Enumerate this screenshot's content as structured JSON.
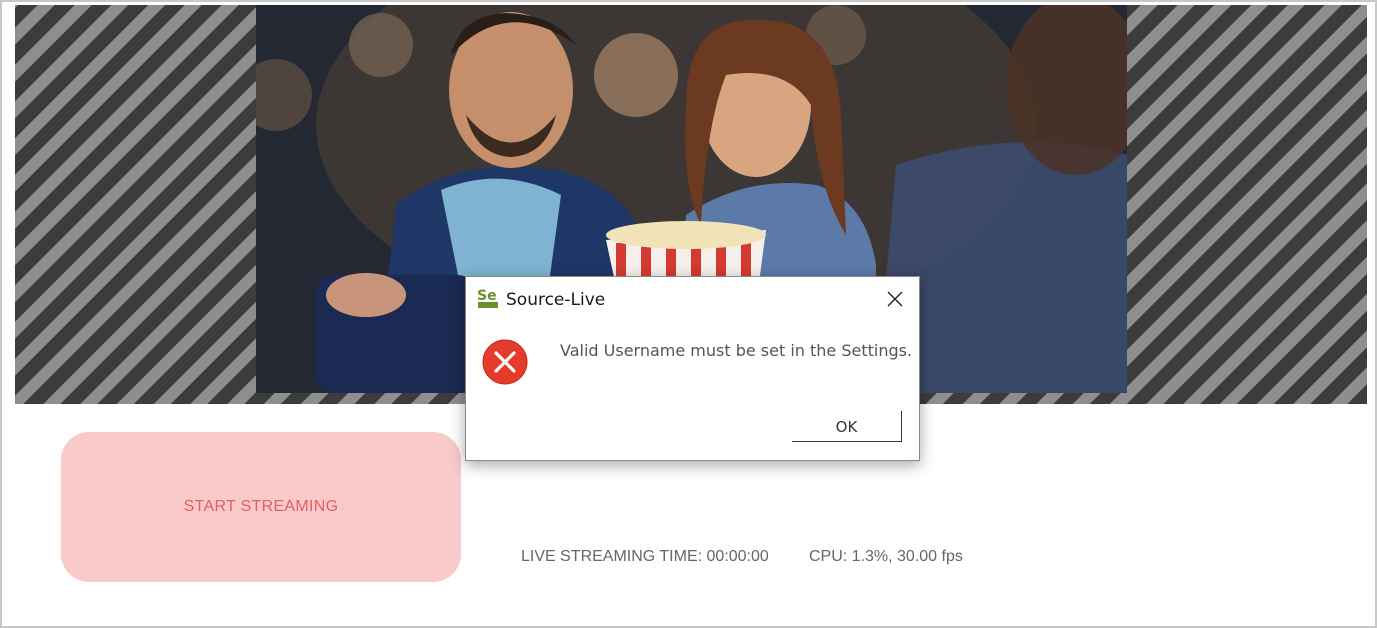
{
  "main": {
    "start_streaming_label": "START STREAMING",
    "live_streaming_time": "LIVE STREAMING TIME: 00:00:00",
    "cpu_status": "CPU: 1.3%, 30.00 fps"
  },
  "dialog": {
    "title": "Source-Live",
    "icon_text": "Se",
    "message": "Valid Username must be set in the Settings.",
    "ok_label": "OK"
  },
  "colors": {
    "start_button_bg": "#f8caca",
    "start_button_text": "#e55f5f",
    "error_icon": "#e53b2a",
    "app_icon_green": "#6a8f2e"
  },
  "icons": {
    "app": "source-live-app-icon",
    "close": "close-icon",
    "error": "error-icon"
  }
}
